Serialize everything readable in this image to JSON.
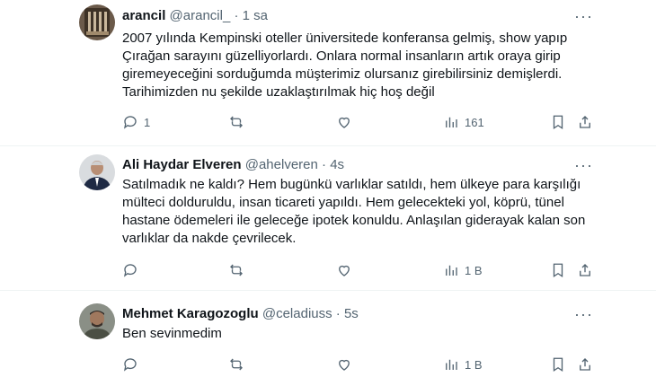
{
  "tweets": [
    {
      "name": "arancil",
      "handle": "@arancil_",
      "sep": "·",
      "time": "1 sa",
      "text": "2007 yılında Kempinski oteller üniversitede konferansa gelmiş, show yapıp Çırağan sarayını güzelliyorlardı. Onlara normal insanların artık oraya girip giremeyeceğini sorduğumda müşterimiz olursanız girebilirsiniz demişlerdi. Tarihimizden nu şekilde uzaklaştırılmak hiç hoş değil",
      "replies": "1",
      "reposts": "",
      "likes": "",
      "views": "161"
    },
    {
      "name": "Ali Haydar Elveren",
      "handle": "@ahelveren",
      "sep": "·",
      "time": "4s",
      "text": "Satılmadık ne kaldı? Hem bugünkü varlıklar satıldı, hem ülkeye para karşılığı mülteci dolduruldu, insan ticareti yapıldı. Hem gelecekteki yol, köprü, tünel hastane ödemeleri ile geleceğe ipotek konuldu. Anlaşılan giderayak kalan son varlıklar da nakde çevrilecek.",
      "replies": "",
      "reposts": "",
      "likes": "",
      "views": "1 B"
    },
    {
      "name": "Mehmet Karagozoglu",
      "handle": "@celadiuss",
      "sep": "·",
      "time": "5s",
      "text": "Ben sevinmedim",
      "replies": "",
      "reposts": "",
      "likes": "",
      "views": "1 B"
    }
  ],
  "icons": {
    "reply": "reply-icon",
    "repost": "repost-icon",
    "like": "like-icon",
    "views": "views-icon",
    "bookmark": "bookmark-icon",
    "share": "share-icon",
    "more": "more-icon"
  },
  "colors": {
    "text": "#0f1419",
    "secondary": "#536471",
    "divider": "#eff3f4"
  }
}
